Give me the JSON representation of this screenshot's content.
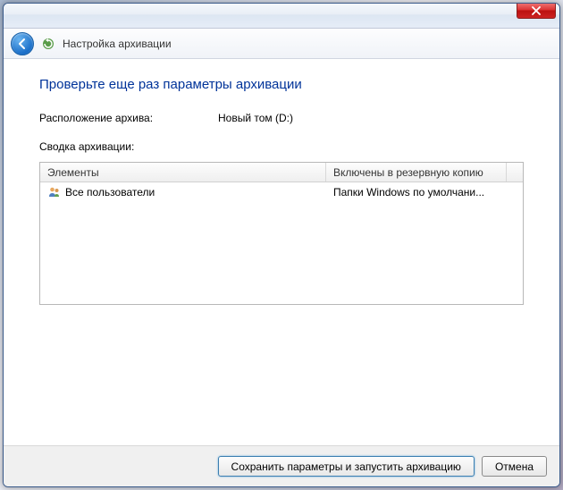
{
  "window": {
    "title": "Настройка архивации"
  },
  "page": {
    "heading": "Проверьте еще раз параметры архивации",
    "location_label": "Расположение архива:",
    "location_value": "Новый том (D:)",
    "summary_label": "Сводка архивации:"
  },
  "listview": {
    "columns": {
      "elements": "Элементы",
      "included": "Включены в резервную копию"
    },
    "row": {
      "name": "Все пользователи",
      "value": "Папки Windows по умолчани..."
    }
  },
  "footer": {
    "save": "Сохранить параметры и запустить архивацию",
    "cancel": "Отмена"
  }
}
